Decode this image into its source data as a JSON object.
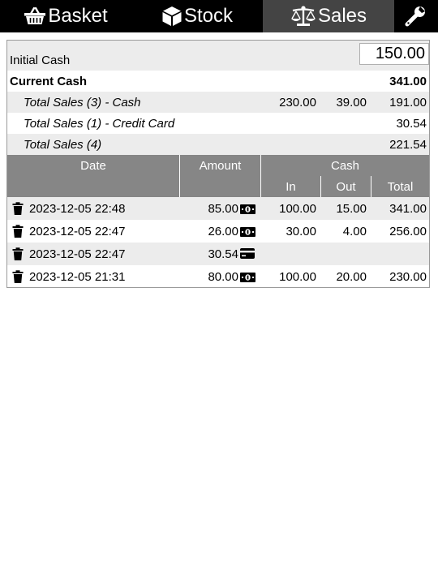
{
  "nav": {
    "tabs": [
      {
        "label": "Basket",
        "icon": "basket-icon"
      },
      {
        "label": "Stock",
        "icon": "box-icon"
      },
      {
        "label": "Sales",
        "icon": "scale-icon",
        "active": true
      },
      {
        "label": "",
        "icon": "wrench-icon"
      }
    ]
  },
  "summary": {
    "initial_cash_label": "Initial Cash",
    "initial_cash_value": "150.00",
    "current_cash_label": "Current Cash",
    "current_cash_value": "341.00",
    "rows": [
      {
        "label": "Total Sales (3) - Cash",
        "in": "230.00",
        "out": "39.00",
        "total": "191.00"
      },
      {
        "label": "Total Sales (1) - Credit Card",
        "in": "",
        "out": "",
        "total": "30.54"
      },
      {
        "label": "Total Sales (4)",
        "in": "",
        "out": "",
        "total": "221.54"
      }
    ]
  },
  "table": {
    "headers": {
      "date": "Date",
      "amount": "Amount",
      "cash": "Cash",
      "in": "In",
      "out": "Out",
      "total": "Total"
    },
    "rows": [
      {
        "date": "2023-12-05 22:48",
        "amount": "85.00",
        "method": "cash-icon",
        "in": "100.00",
        "out": "15.00",
        "total": "341.00"
      },
      {
        "date": "2023-12-05 22:47",
        "amount": "26.00",
        "method": "cash-icon",
        "in": "30.00",
        "out": "4.00",
        "total": "256.00"
      },
      {
        "date": "2023-12-05 22:47",
        "amount": "30.54",
        "method": "credit-card-icon",
        "in": "",
        "out": "",
        "total": ""
      },
      {
        "date": "2023-12-05 21:31",
        "amount": "80.00",
        "method": "cash-icon",
        "in": "100.00",
        "out": "20.00",
        "total": "230.00"
      }
    ]
  },
  "colors": {
    "nav_bg": "#000000",
    "active_tab_bg": "#444444",
    "header_bg": "#868686",
    "stripe_bg": "#ececec"
  }
}
